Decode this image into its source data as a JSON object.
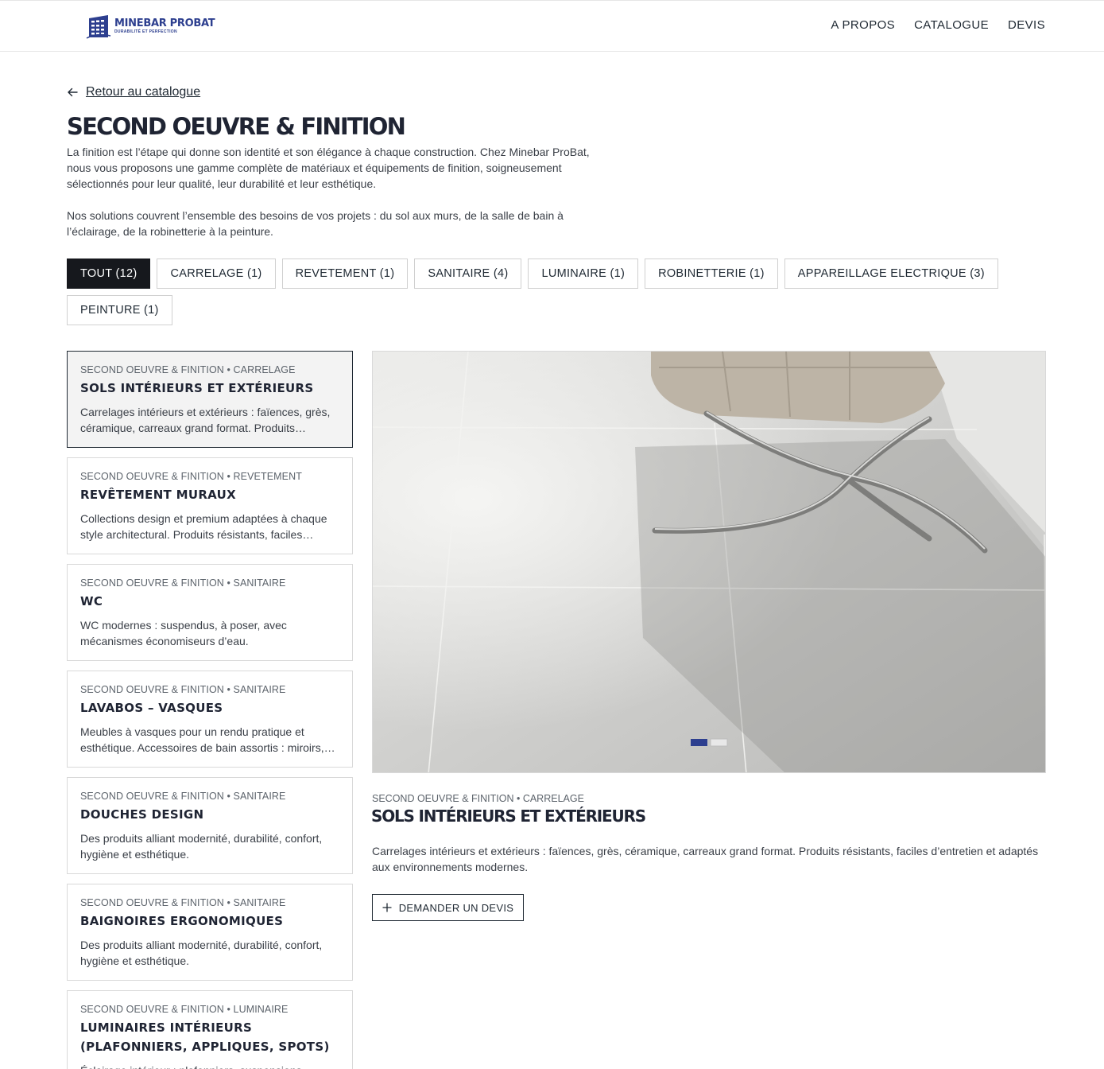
{
  "header": {
    "logo_name": "MINEBAR PROBAT",
    "logo_tagline": "DURABILITÉ ET PERFECTION",
    "brand_color": "#2d3f8f",
    "nav": [
      {
        "label": "A PROPOS"
      },
      {
        "label": "CATALOGUE"
      },
      {
        "label": "DEVIS"
      }
    ]
  },
  "back_link": {
    "label": "Retour au catalogue",
    "icon": "arrow-left-icon"
  },
  "page": {
    "title": "SECOND OEUVRE & FINITION",
    "intro_1": "La finition est l’étape qui donne son identité et son élégance à chaque construction. Chez Minebar ProBat, nous vous proposons une gamme complète de matériaux et équipements de finition, soigneusement sélectionnés pour leur qualité, leur durabilité et leur esthétique.",
    "intro_2": "Nos solutions couvrent l’ensemble des besoins de vos projets : du sol aux murs, de la salle de bain à l’éclairage, de la robinetterie à la peinture."
  },
  "filters": [
    {
      "label": "TOUT (12)",
      "active": true
    },
    {
      "label": "CARRELAGE (1)"
    },
    {
      "label": "REVETEMENT (1)"
    },
    {
      "label": "SANITAIRE (4)"
    },
    {
      "label": "LUMINAIRE (1)"
    },
    {
      "label": "ROBINETTERIE (1)"
    },
    {
      "label": "APPAREILLAGE ELECTRIQUE (3)"
    },
    {
      "label": "PEINTURE (1)"
    }
  ],
  "products": [
    {
      "category": "SECOND OEUVRE & FINITION • CARRELAGE",
      "title": "SOLS INTÉRIEURS ET EXTÉRIEURS",
      "desc": "Carrelages intérieurs et extérieurs : faïences, grès, céramique, carreaux grand format. Produits…",
      "selected": true
    },
    {
      "category": "SECOND OEUVRE & FINITION • REVETEMENT",
      "title": "REVÊTEMENT MURAUX",
      "desc": "Collections design et premium adaptées à chaque style architectural. Produits résistants, faciles…"
    },
    {
      "category": "SECOND OEUVRE & FINITION • SANITAIRE",
      "title": "WC",
      "desc": "WC modernes : suspendus, à poser, avec mécanismes économiseurs d’eau."
    },
    {
      "category": "SECOND OEUVRE & FINITION • SANITAIRE",
      "title": "LAVABOS – VASQUES",
      "desc": "Meubles à vasques pour un rendu pratique et esthétique. Accessoires de bain assortis : miroirs,…"
    },
    {
      "category": "SECOND OEUVRE & FINITION • SANITAIRE",
      "title": "DOUCHES DESIGN",
      "desc": "Des produits alliant modernité, durabilité, confort, hygiène et esthétique."
    },
    {
      "category": "SECOND OEUVRE & FINITION • SANITAIRE",
      "title": "BAIGNOIRES ERGONOMIQUES",
      "desc": "Des produits alliant modernité, durabilité, confort, hygiène et esthétique."
    },
    {
      "category": "SECOND OEUVRE & FINITION • LUMINAIRE",
      "title": "LUMINAIRES INTÉRIEURS (PLAFONNIERS, APPLIQUES, SPOTS)",
      "desc": "Éclairage intérieur : plafonniers, suspensions…"
    }
  ],
  "detail": {
    "category": "SECOND OEUVRE & FINITION • CARRELAGE",
    "title": "SOLS INTÉRIEURS ET EXTÉRIEURS",
    "desc": "Carrelages intérieurs et extérieurs : faïences, grès, céramique, carreaux grand format. Produits résistants, faciles d’entretien et adaptés aux environnements modernes.",
    "button_label": "DEMANDER UN DEVIS",
    "image_alt": "Sol en carrelage gris grand format avec fauteuil design",
    "slide_count": 2,
    "active_slide": 1
  }
}
